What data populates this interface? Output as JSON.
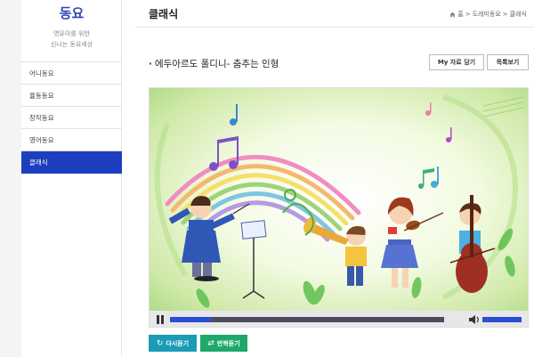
{
  "sidebar": {
    "title": "동요",
    "subtitle_line1": "영유아를 위한",
    "subtitle_line2": "신나는 동요세상",
    "items": [
      {
        "label": "어니동요",
        "active": false
      },
      {
        "label": "율동동요",
        "active": false
      },
      {
        "label": "창작동요",
        "active": false
      },
      {
        "label": "영어동요",
        "active": false
      },
      {
        "label": "클래식",
        "active": true
      }
    ]
  },
  "header": {
    "title": "클래식",
    "breadcrumb": {
      "home": "홈",
      "sep1": ">",
      "level1": "도레미동요",
      "sep2": ">",
      "level2": "클래식"
    }
  },
  "song": {
    "title": "에두아르도 폴디니- 춤추는 인형",
    "my_button": "My 자료 담기",
    "list_button": "목록보기"
  },
  "player": {
    "progress_percent": 15,
    "volume_percent": 100
  },
  "buttons": {
    "replay": "다시듣기",
    "repeat": "반복듣기"
  },
  "colors": {
    "accent": "#1e3ec0",
    "replay": "#1a9bb6",
    "repeat": "#1fa86b",
    "progress_track": "#4c4c5c",
    "progress_fill": "#2b4fd1"
  }
}
